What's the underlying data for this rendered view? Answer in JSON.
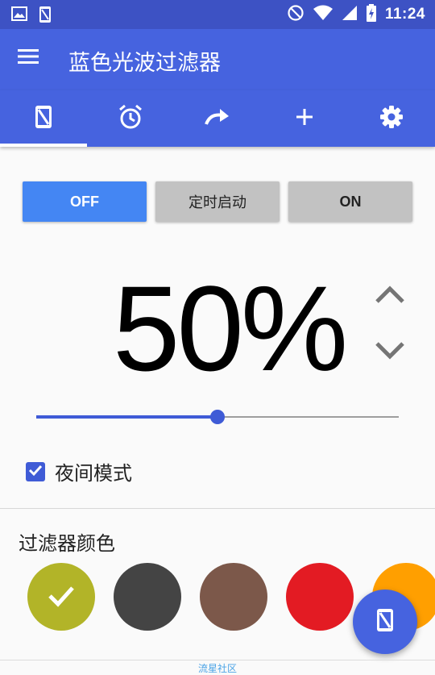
{
  "status_bar": {
    "time": "11:24",
    "left_icons": [
      "image-icon",
      "phone-filter-icon"
    ],
    "right_icons": [
      "do-not-disturb-icon",
      "wifi-icon",
      "signal-icon",
      "battery-charging-icon"
    ]
  },
  "app_bar": {
    "title": "蓝色光波过滤器",
    "menu_icon": "hamburger-menu-icon"
  },
  "tabs": [
    {
      "icon": "phone-filter-icon",
      "active": true
    },
    {
      "icon": "alarm-clock-icon",
      "active": false
    },
    {
      "icon": "redo-arrow-icon",
      "active": false
    },
    {
      "icon": "plus-icon",
      "active": false
    },
    {
      "icon": "gear-icon",
      "active": false
    }
  ],
  "mode_buttons": {
    "off": "OFF",
    "timer": "定时启动",
    "on": "ON",
    "selected": "off"
  },
  "filter": {
    "percent_text": "50%",
    "slider_value": 0.5
  },
  "night_mode": {
    "label": "夜间模式",
    "checked": true
  },
  "colors_section": {
    "title": "过滤器颜色",
    "swatches": [
      "#b2b428",
      "#444444",
      "#7c584a",
      "#e31b23",
      "#ff9f00"
    ],
    "selected_index": 0
  },
  "watermark": "流星社区",
  "theme": {
    "primary": "#4663df",
    "status_bar": "#3d52c4",
    "accent": "#3f5bd6",
    "off_button": "#4486f3"
  }
}
